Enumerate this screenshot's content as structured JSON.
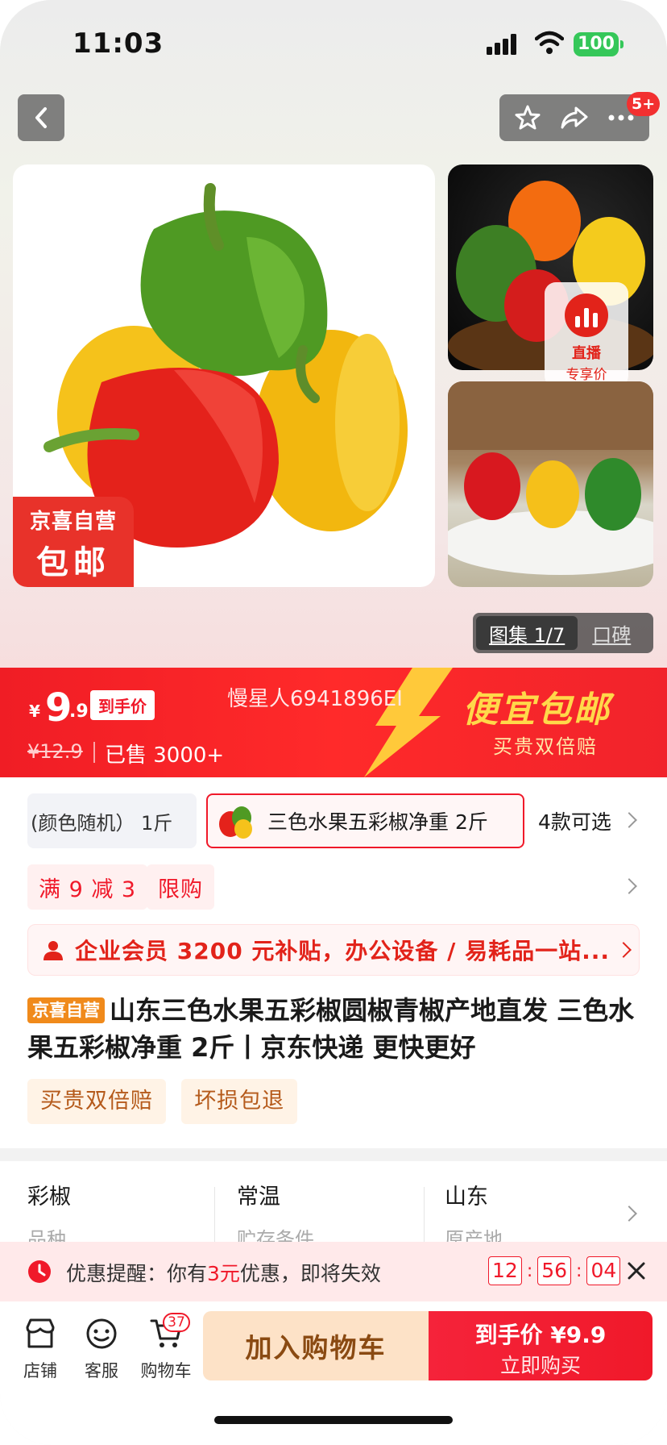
{
  "status": {
    "time": "11:03",
    "battery": "100"
  },
  "header": {
    "more_badge": "5+"
  },
  "gallery": {
    "badge_line1": "京喜自营",
    "badge_line2": "包邮",
    "live_line1": "直播",
    "live_line2": "专享价",
    "tab_active": "图集 1/7",
    "tab_inactive": "口碑"
  },
  "price": {
    "currency": "¥",
    "integer": "9",
    "decimal": ".9",
    "to_hand_label": "到手价",
    "original": "¥12.9",
    "sold": "已售 3000+",
    "watermark": "慢星人6941896EI",
    "promo_title": "便宜包邮",
    "promo_sub": "买贵双倍赔"
  },
  "spec": {
    "option1": "(颜色随机）  1斤",
    "option2": "三色水果五彩椒净重 2斤",
    "more": "4款可选"
  },
  "coupons": [
    "满 9 减 3",
    "限购"
  ],
  "member_banner": "企业会员 3200 元补贴，办公设备 / 易耗品一站...",
  "product": {
    "tag": "京喜自营",
    "title": "山东三色水果五彩椒圆椒青椒产地直发 三色水果五彩椒净重 2斤丨京东快递 更快更好"
  },
  "services": [
    "买贵双倍赔",
    "坏损包退"
  ],
  "attributes": [
    {
      "value": "彩椒",
      "key": "品种"
    },
    {
      "value": "常温",
      "key": "贮存条件"
    },
    {
      "value": "山东",
      "key": "原产地"
    }
  ],
  "reminder": {
    "prefix": "优惠提醒：你有",
    "amount": "3元",
    "suffix": "优惠，即将失效",
    "timer": [
      "12",
      "56",
      "04"
    ]
  },
  "bottom": {
    "store": "店铺",
    "service": "客服",
    "cart": "购物车",
    "cart_count": "37",
    "add_to_cart": "加入购物车",
    "buy_line1": "到手价 ¥9.9",
    "buy_line2": "立即购买"
  },
  "colors": {
    "accent": "#f0192a",
    "gold": "#ffd84a",
    "orange_tag": "#f08a1b"
  }
}
